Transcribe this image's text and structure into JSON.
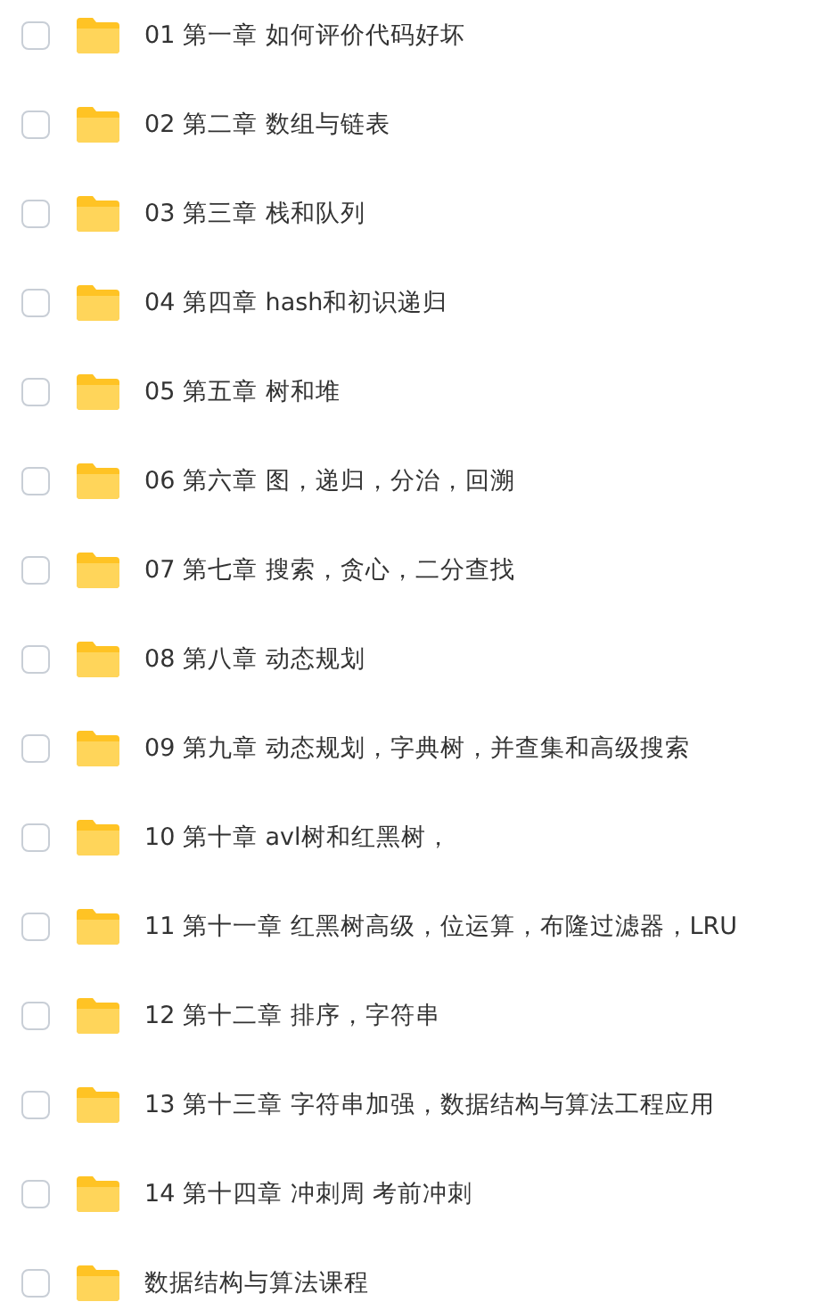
{
  "folders": [
    {
      "name": "01 第一章 如何评价代码好坏",
      "checked": false
    },
    {
      "name": "02 第二章 数组与链表",
      "checked": false
    },
    {
      "name": "03 第三章 栈和队列",
      "checked": false
    },
    {
      "name": "04 第四章 hash和初识递归",
      "checked": false
    },
    {
      "name": "05 第五章 树和堆",
      "checked": false
    },
    {
      "name": "06 第六章 图，递归，分治，回溯",
      "checked": false
    },
    {
      "name": "07 第七章 搜索，贪心，二分查找",
      "checked": false
    },
    {
      "name": "08 第八章 动态规划",
      "checked": false
    },
    {
      "name": "09 第九章 动态规划，字典树，并查集和高级搜索",
      "checked": false
    },
    {
      "name": "10 第十章 avl树和红黑树，",
      "checked": false
    },
    {
      "name": "11 第十一章 红黑树高级，位运算，布隆过滤器，LRU",
      "checked": false
    },
    {
      "name": "12 第十二章 排序，字符串",
      "checked": false
    },
    {
      "name": "13 第十三章 字符串加强，数据结构与算法工程应用",
      "checked": false
    },
    {
      "name": "14 第十四章 冲刺周 考前冲刺",
      "checked": false
    },
    {
      "name": "数据结构与算法课程",
      "checked": false
    }
  ]
}
